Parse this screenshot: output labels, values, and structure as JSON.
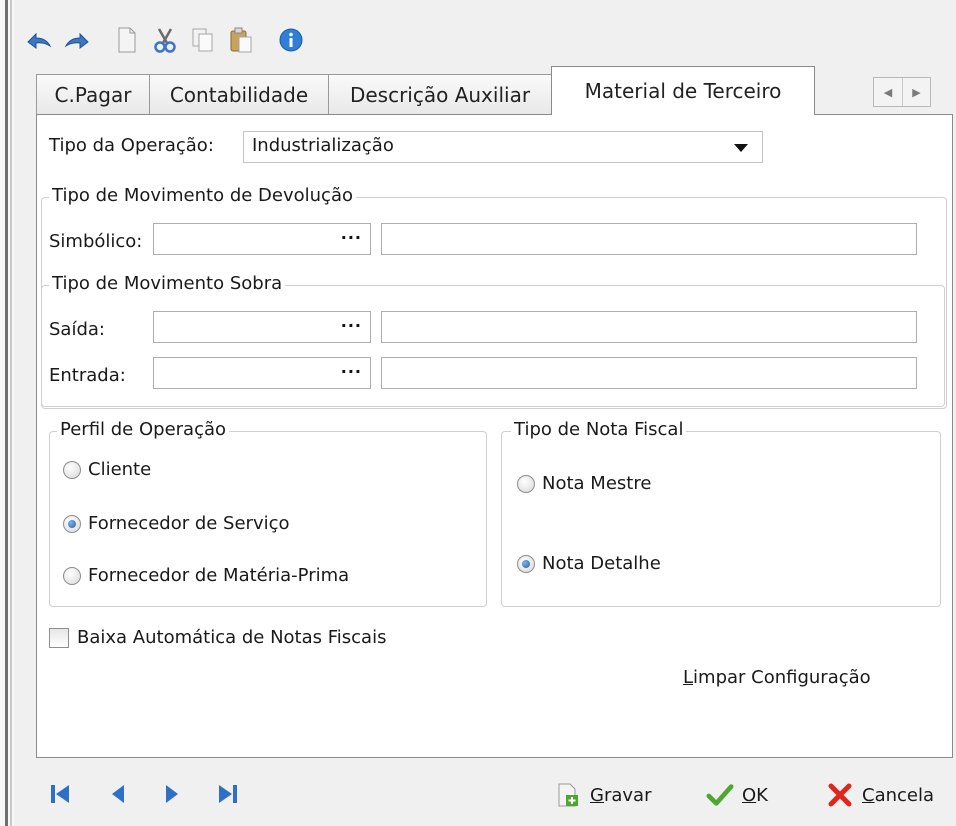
{
  "toolbar": {
    "buttons": [
      {
        "icon": "undo-icon"
      },
      {
        "icon": "redo-icon"
      },
      {
        "icon": "new-document-icon"
      },
      {
        "icon": "cut-icon"
      },
      {
        "icon": "copy-icon"
      },
      {
        "icon": "paste-icon"
      },
      {
        "icon": "info-icon"
      }
    ]
  },
  "tabs": [
    {
      "label": "C.Pagar",
      "active": false
    },
    {
      "label": "Contabilidade",
      "active": false
    },
    {
      "label": "Descrição Auxiliar",
      "active": false
    },
    {
      "label": "Material de Terceiro",
      "active": true
    }
  ],
  "form": {
    "tipo_operacao_label": "Tipo da Operação:",
    "tipo_operacao_value": "Industrialização",
    "devolucao_group_title": "Tipo de Movimento de Devolução",
    "simbolico_label": "Simbólico:",
    "simbolico_code": "",
    "simbolico_desc": "",
    "sobra_group_title": "Tipo de Movimento Sobra",
    "saida_label": "Saída:",
    "saida_code": "",
    "saida_desc": "",
    "entrada_label": "Entrada:",
    "entrada_code": "",
    "entrada_desc": "",
    "lookup_dots": "···",
    "perfil_group_title": "Perfil de Operação",
    "perfil_options": [
      {
        "label": "Cliente",
        "selected": false
      },
      {
        "label": "Fornecedor de Serviço",
        "selected": true
      },
      {
        "label": "Fornecedor de Matéria-Prima",
        "selected": false
      }
    ],
    "nota_group_title": "Tipo de Nota Fiscal",
    "nota_options": [
      {
        "label": "Nota Mestre",
        "selected": false
      },
      {
        "label": "Nota Detalhe",
        "selected": true
      }
    ],
    "baixa_label": "Baixa Automática de Notas Fiscais",
    "baixa_checked": false,
    "limpar_first": "L",
    "limpar_rest": "impar Configuração"
  },
  "bottom": {
    "nav": [
      {
        "icon": "first-record-icon"
      },
      {
        "icon": "previous-record-icon"
      },
      {
        "icon": "next-record-icon"
      },
      {
        "icon": "last-record-icon"
      }
    ],
    "gravar_first": "G",
    "gravar_rest": "ravar",
    "ok_first": "O",
    "ok_rest": "K",
    "cancela_first": "C",
    "cancela_rest": "ancela"
  },
  "colors": {
    "nav_blue": "#2e6fc7",
    "ok_green": "#4ea82f",
    "cancel_red": "#e0261c",
    "radio_selected": "#1d5fb0"
  }
}
